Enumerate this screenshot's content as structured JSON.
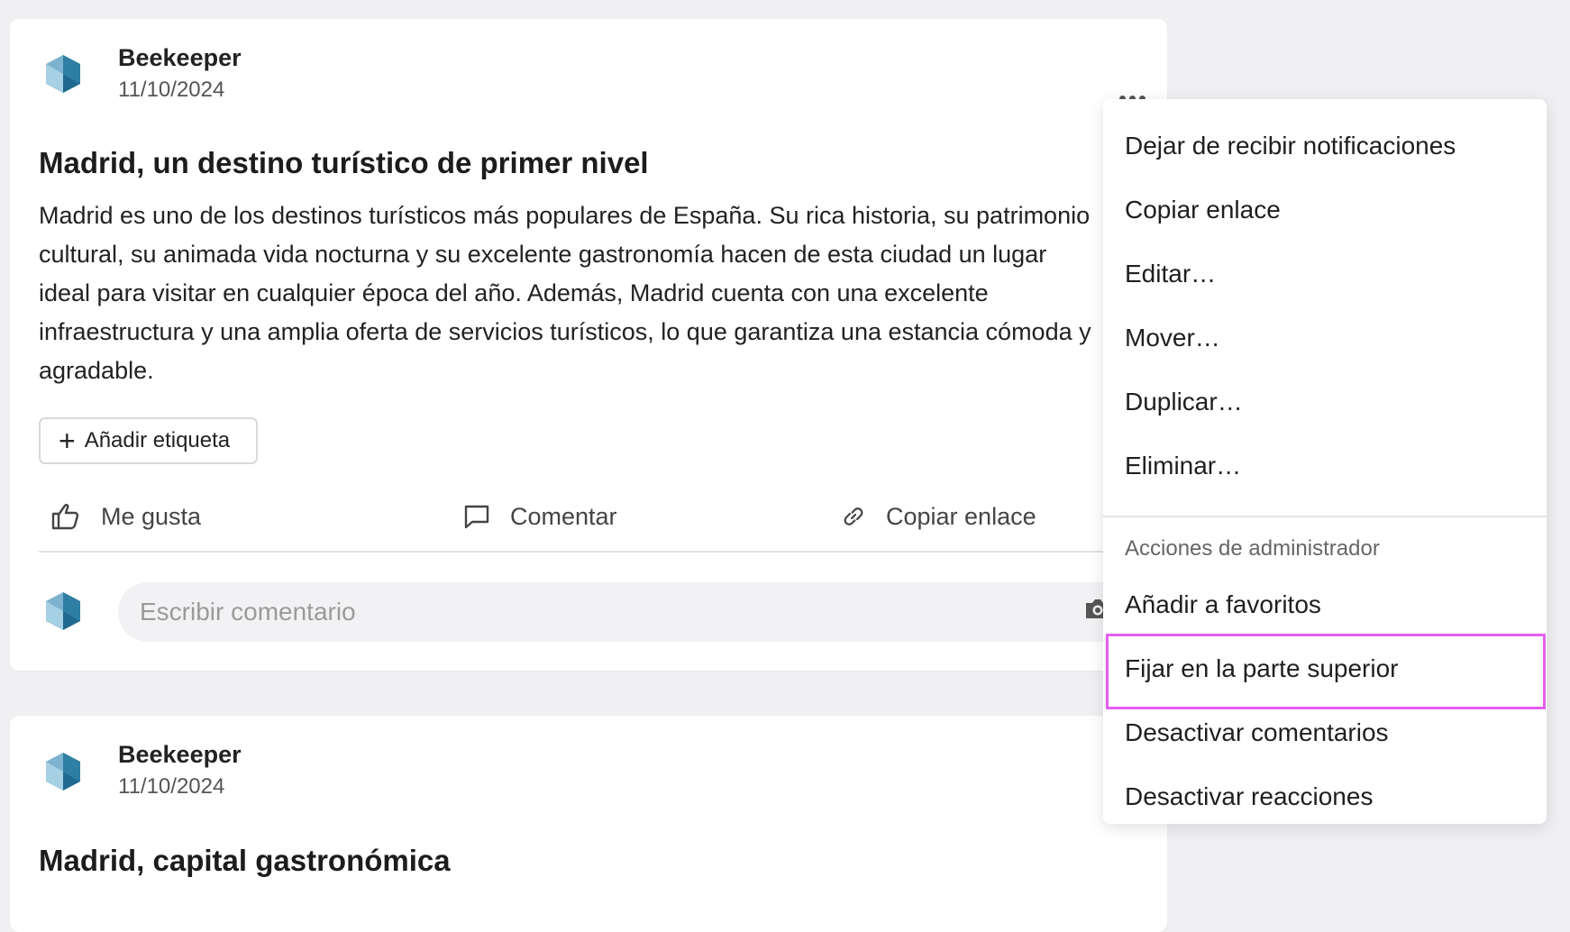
{
  "posts": [
    {
      "author": "Beekeeper",
      "date": "11/10/2024",
      "title": "Madrid, un destino turístico de primer nivel",
      "body_lines": [
        "Madrid es uno de los destinos turísticos más populares de España. Su rica historia, su patrimonio",
        "cultural, su animada vida nocturna y su excelente gastronomía hacen de esta ciudad un lugar",
        "ideal para visitar en cualquier época del año. Además, Madrid cuenta con una excelente",
        "infraestructura y una amplia oferta de servicios turísticos, lo que garantiza una estancia cómoda y",
        "agradable."
      ],
      "tag_button": "Añadir etiqueta",
      "actions": {
        "like": "Me gusta",
        "comment": "Comentar",
        "copy_link": "Copiar enlace"
      },
      "comment_placeholder": "Escribir comentario"
    },
    {
      "author": "Beekeeper",
      "date": "11/10/2024",
      "title": "Madrid, capital gastronómica"
    }
  ],
  "menu": {
    "items": [
      "Dejar de recibir notificaciones",
      "Copiar enlace",
      "Editar…",
      "Mover…",
      "Duplicar…",
      "Eliminar…"
    ],
    "admin_section": "Acciones de administrador",
    "admin_items": [
      "Añadir a favoritos",
      "Fijar en la parte superior",
      "Desactivar comentarios",
      "Desactivar reacciones"
    ],
    "highlighted_item": "Fijar en la parte superior"
  },
  "colors": {
    "highlight": "#e45ff0",
    "avatar_light": "#8fc1d9",
    "avatar_dark": "#2f7ea3"
  },
  "icons": [
    "avatar-logo-icon",
    "more-options-icon",
    "plus-icon",
    "thumbs-up-icon",
    "comment-icon",
    "link-icon",
    "camera-icon"
  ]
}
